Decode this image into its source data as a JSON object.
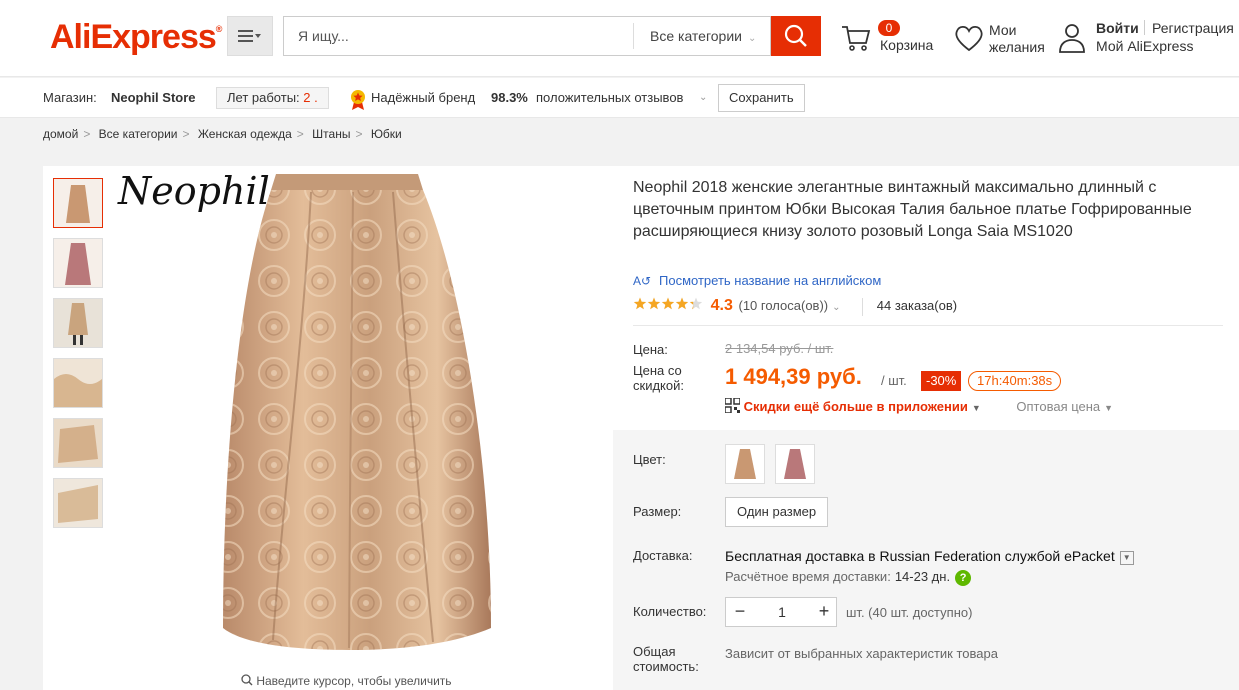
{
  "header": {
    "logo": "AliExpress",
    "logo_mark": "®",
    "search_placeholder": "Я ищу...",
    "category": "Все категории",
    "cart_count": "0",
    "cart_label": "Корзина",
    "wishlist_label": "Мои желания",
    "login": "Войти",
    "register": "Регистрация",
    "my_account": "Мой AliExpress",
    "accent": "#e62e04"
  },
  "store": {
    "label": "Магазин:",
    "name": "Neophil Store",
    "years_label": "Лет работы:",
    "years_value": "2 .",
    "brand_label": "Надёжный бренд",
    "rating_pct": "98.3%",
    "rating_label": "положительных отзывов",
    "save": "Сохранить"
  },
  "breadcrumb": [
    "домой",
    "Все категории",
    "Женская одежда",
    "Штаны",
    "Юбки"
  ],
  "gallery": {
    "watermark": "Neophil",
    "zoom_hint": "Наведите курсор, чтобы увеличить"
  },
  "product": {
    "title": "Neophil 2018 женские элегантные винтажный максимально длинный с цветочным принтом Юбки Высокая Талия бальное платье Гофрированные расширяющиеся книзу золото розовый Longa Saia MS1020",
    "translate_link": "Посмотреть название на английском",
    "rating": "4.3",
    "rating_fraction": 0.86,
    "votes": "(10 голоса(ов))",
    "orders": "44 заказа(ов)",
    "price_label": "Цена:",
    "old_price": "2 134,54 руб. / шт.",
    "discount_price_label": "Цена со скидкой:",
    "new_price": "1 494,39 руб.",
    "per_unit": "/ шт.",
    "discount": "-30%",
    "timer": "17h:40m:38s",
    "app_discount": "Скидки ещё больше в приложении",
    "wholesale": "Оптовая цена",
    "color_label": "Цвет:",
    "size_label": "Размер:",
    "size_option": "Один размер",
    "shipping_label": "Доставка:",
    "shipping_text": "Бесплатная доставка в Russian Federation службой ePacket",
    "shipping_time_label": "Расчётное время доставки:",
    "shipping_days": "14-23 дн.",
    "qty_label": "Количество:",
    "qty_value": "1",
    "qty_note": "шт. (40 шт. доступно)",
    "total_label": "Общая стоимость:",
    "total_note": "Зависит от выбранных характеристик товара"
  }
}
